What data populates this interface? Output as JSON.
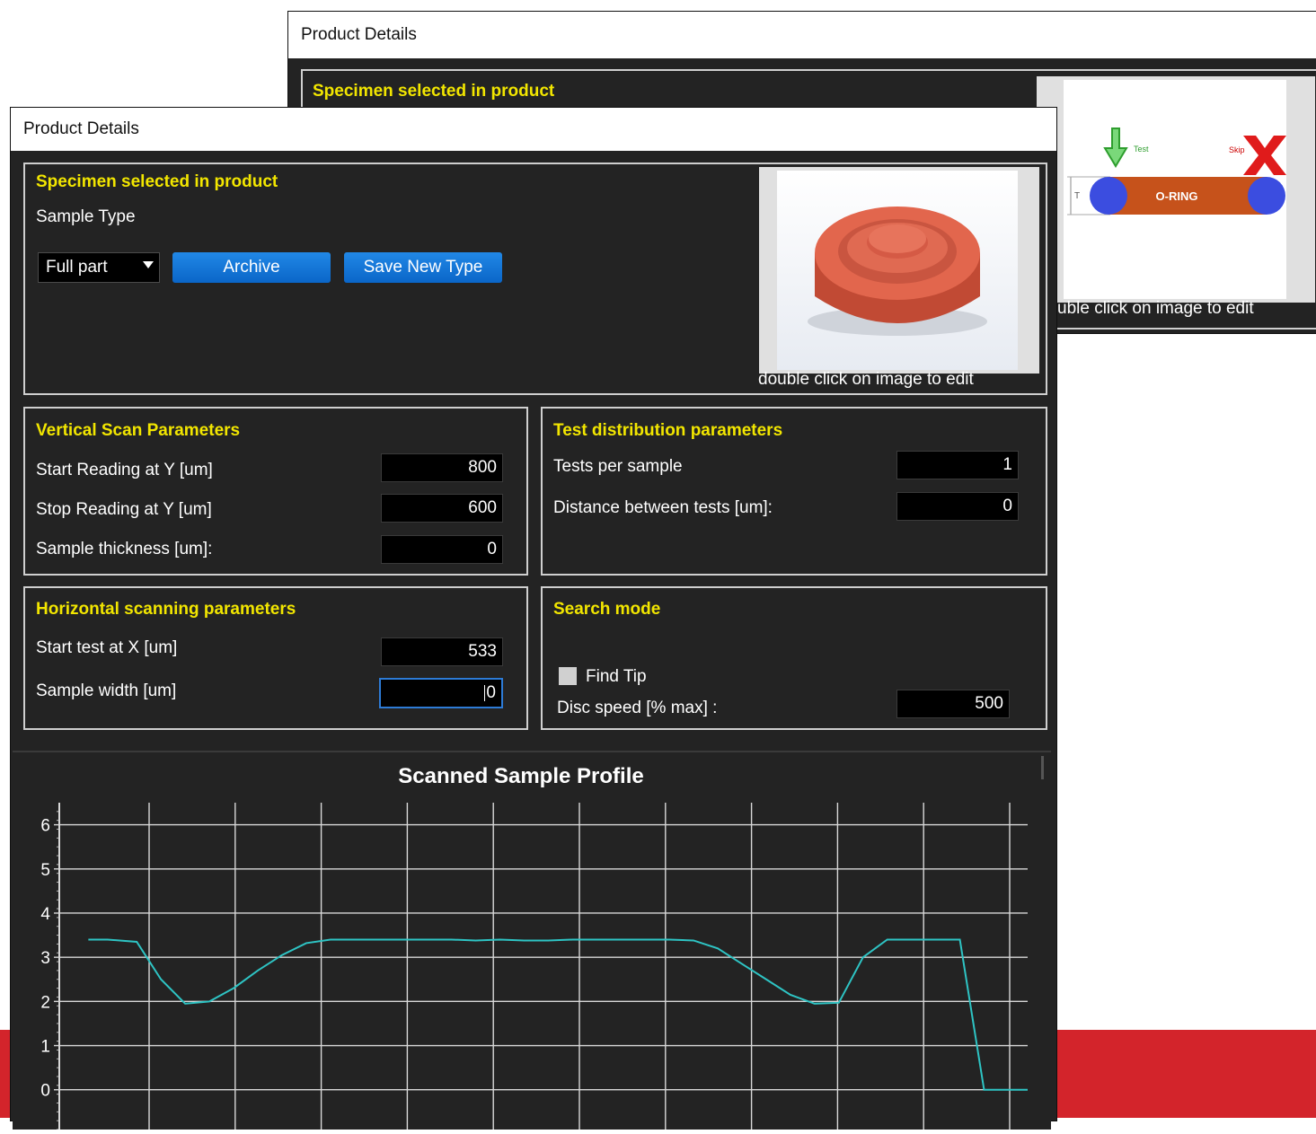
{
  "back_window": {
    "title": "Product Details",
    "section_title": "Specimen selected in product",
    "image_hint": "uble click on image to edit",
    "diagram": {
      "test_label": "Test",
      "skip_label": "Skip",
      "oring_label": "O-RING",
      "t_label": "T"
    }
  },
  "front_window": {
    "title": "Product Details",
    "specimen": {
      "title": "Specimen selected in product",
      "sample_type_label": "Sample Type",
      "sample_type_value": "Full part",
      "archive_button": "Archive",
      "save_new_type_button": "Save New Type",
      "image_hint": "double click on image to edit"
    },
    "vertical": {
      "title": "Vertical Scan Parameters",
      "start_label": "Start Reading at Y [um]",
      "start_value": "800",
      "stop_label": "Stop Reading at Y [um]",
      "stop_value": "600",
      "thickness_label": "Sample thickness [um]:",
      "thickness_value": "0"
    },
    "distribution": {
      "title": "Test distribution parameters",
      "tests_label": "Tests per sample",
      "tests_value": "1",
      "distance_label": "Distance between tests [um]:",
      "distance_value": "0"
    },
    "horizontal": {
      "title": "Horizontal scanning parameters",
      "start_label": "Start test at X [um]",
      "start_value": "533",
      "width_label": "Sample width [um]",
      "width_value": "0"
    },
    "search": {
      "title": "Search mode",
      "find_tip_label": "Find Tip",
      "find_tip_checked": false,
      "disc_label": "Disc speed [% max] :",
      "disc_value": "500"
    }
  },
  "chart_data": {
    "type": "line",
    "title": "Scanned Sample Profile",
    "xlabel": "",
    "ylabel": "",
    "ylim": [
      -0.9,
      6.5
    ],
    "xlim": [
      0,
      1
    ],
    "grid": true,
    "y_ticks": [
      "0",
      "1",
      "2",
      "3",
      "4",
      "5",
      "6"
    ],
    "series": [
      {
        "color": "#2ec4c4",
        "x": [
          0.03,
          0.05,
          0.08,
          0.105,
          0.13,
          0.155,
          0.18,
          0.205,
          0.23,
          0.255,
          0.28,
          0.305,
          0.33,
          0.355,
          0.38,
          0.405,
          0.43,
          0.455,
          0.48,
          0.505,
          0.53,
          0.555,
          0.58,
          0.605,
          0.63,
          0.655,
          0.68,
          0.705,
          0.73,
          0.755,
          0.78,
          0.805,
          0.83,
          0.855,
          0.88,
          0.905,
          0.93,
          0.955,
          0.98,
          1.0
        ],
        "y": [
          3.4,
          3.4,
          3.35,
          2.5,
          1.95,
          2.0,
          2.3,
          2.7,
          3.05,
          3.32,
          3.4,
          3.4,
          3.4,
          3.4,
          3.4,
          3.4,
          3.38,
          3.4,
          3.38,
          3.38,
          3.4,
          3.4,
          3.4,
          3.4,
          3.4,
          3.38,
          3.2,
          2.85,
          2.5,
          2.15,
          1.95,
          1.97,
          3.0,
          3.4,
          3.4,
          3.4,
          3.4,
          0.0,
          0.0,
          0.0
        ]
      }
    ]
  }
}
